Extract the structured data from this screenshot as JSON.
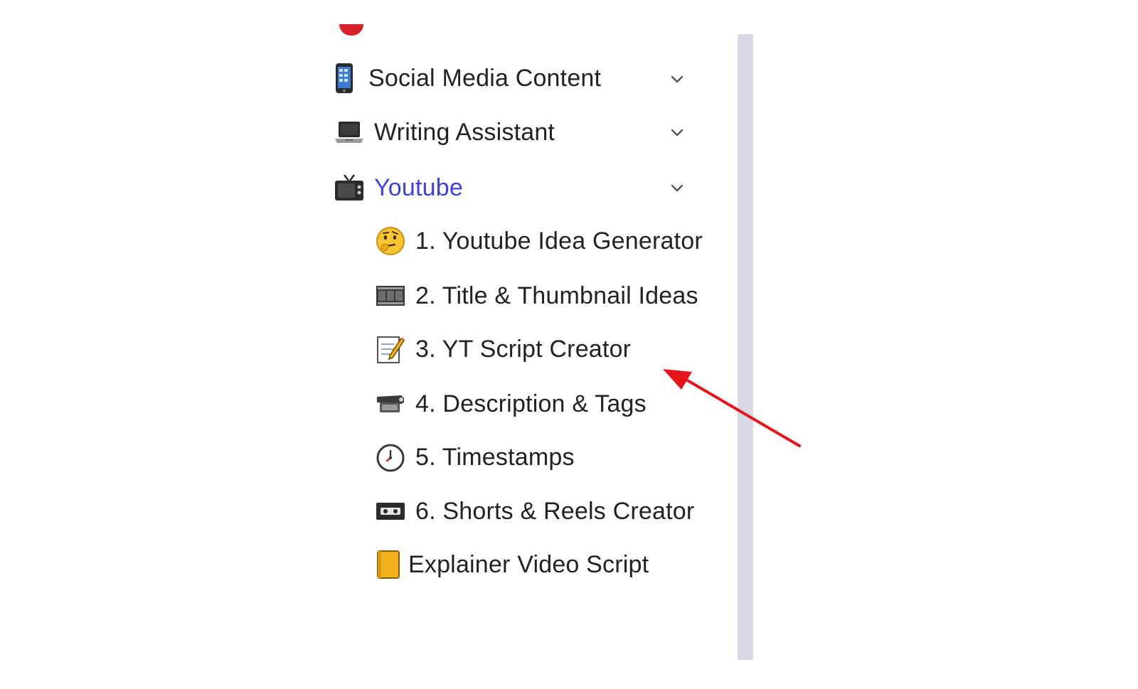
{
  "sidebar": {
    "sections": [
      {
        "label": "Social Media Content",
        "icon": "mobile-phone-icon",
        "expanded": false
      },
      {
        "label": "Writing Assistant",
        "icon": "laptop-icon",
        "expanded": false
      },
      {
        "label": "Youtube",
        "icon": "television-icon",
        "expanded": true,
        "active": true
      }
    ],
    "youtube_items": [
      {
        "label": "1. Youtube Idea Generator",
        "icon": "thinking-face-icon"
      },
      {
        "label": "2. Title & Thumbnail Ideas",
        "icon": "film-frames-icon"
      },
      {
        "label": "3. YT Script Creator",
        "icon": "memo-icon"
      },
      {
        "label": "4. Description & Tags",
        "icon": "projector-icon"
      },
      {
        "label": "5. Timestamps",
        "icon": "stopwatch-icon"
      },
      {
        "label": "6. Shorts & Reels Creator",
        "icon": "videocassette-icon"
      },
      {
        "label": "Explainer Video Script",
        "icon": "notebook-icon"
      }
    ]
  },
  "colors": {
    "active_text": "#3f3fe6",
    "text": "#222222",
    "scroll_track": "#d6dae4",
    "annotation_arrow": "#e8141b"
  }
}
